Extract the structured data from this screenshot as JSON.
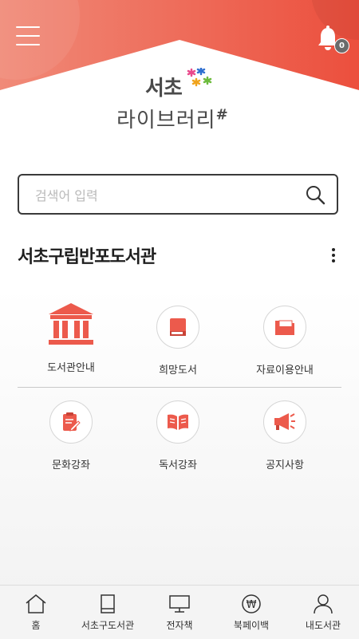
{
  "header": {
    "menu_icon": "hamburger-menu-icon",
    "notification_icon": "bell-icon",
    "notification_count": "0",
    "accent_color": "#ef5b4c"
  },
  "logo": {
    "top_text": "서초",
    "bottom_text": "라이브러리",
    "hash": "#"
  },
  "search": {
    "placeholder": "검색어 입력",
    "value": ""
  },
  "library": {
    "name": "서초구립반포도서관",
    "more_icon": "more-vertical-icon"
  },
  "menu_tiles": [
    {
      "label": "도서관안내",
      "icon": "library-building-icon"
    },
    {
      "label": "희망도서",
      "icon": "book-icon"
    },
    {
      "label": "자료이용안내",
      "icon": "folder-icon"
    },
    {
      "label": "문화강좌",
      "icon": "document-pen-icon"
    },
    {
      "label": "독서강좌",
      "icon": "open-book-icon"
    },
    {
      "label": "공지사항",
      "icon": "megaphone-icon"
    }
  ],
  "bottom_nav": [
    {
      "label": "홈",
      "icon": "home-icon"
    },
    {
      "label": "서초구도서관",
      "icon": "book-icon"
    },
    {
      "label": "전자책",
      "icon": "monitor-icon"
    },
    {
      "label": "북페이백",
      "icon": "won-coin-icon"
    },
    {
      "label": "내도서관",
      "icon": "user-icon"
    }
  ]
}
